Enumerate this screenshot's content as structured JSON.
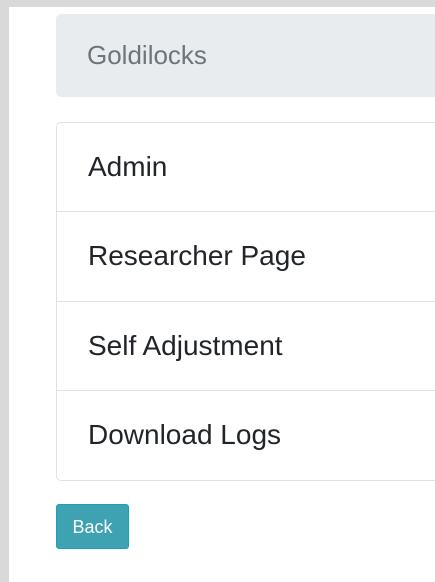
{
  "header": {
    "title": "Goldilocks"
  },
  "menu": {
    "items": [
      {
        "label": "Admin"
      },
      {
        "label": "Researcher Page"
      },
      {
        "label": "Self Adjustment"
      },
      {
        "label": "Download Logs"
      }
    ]
  },
  "actions": {
    "back_label": "Back"
  },
  "colors": {
    "brand_bar_background": "#e9ecef",
    "brand_text": "#6c757d",
    "menu_text": "#212529",
    "border": "#dee2e6",
    "back_button_background": "#3ea2b3",
    "back_button_text": "#ffffff",
    "frame": "#d9d9d9"
  }
}
